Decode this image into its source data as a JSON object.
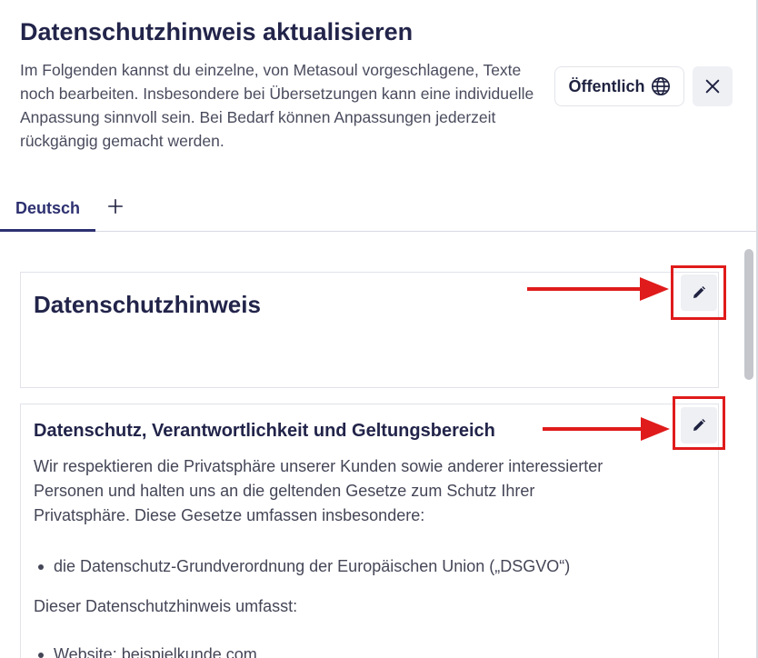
{
  "header": {
    "title": "Datenschutzhinweis aktualisieren",
    "description": "Im Folgenden kannst du einzelne, von Metasoul vorgeschlagene, Texte noch bearbeiten. Insbesondere bei Übersetzungen kann eine individuelle Anpassung sinnvoll sein. Bei Bedarf können Anpassungen jederzeit rückgängig gemacht werden.",
    "visibility_label": "Öffentlich",
    "visibility_icon": "globe-icon",
    "close_icon": "close-icon"
  },
  "tabs": {
    "active_label": "Deutsch",
    "add_icon": "plus-icon"
  },
  "sections": [
    {
      "heading": "Datenschutzhinweis",
      "edit_icon": "pencil-icon"
    },
    {
      "heading": "Datenschutz, Verantwortlichkeit und Geltungsbereich",
      "paragraph": "Wir respektieren die Privatsphäre unserer Kunden sowie anderer interessierter Personen und halten uns an die geltenden Gesetze zum Schutz Ihrer Privatsphäre. Diese Gesetze umfassen insbesondere:",
      "bullet": "die Datenschutz-Grundverordnung der Europäischen Union („DSGVO“)",
      "paragraph2": "Dieser Datenschutzhinweis umfasst:",
      "bullet2": "Website: beispielkunde.com",
      "edit_icon": "pencil-icon"
    }
  ],
  "colors": {
    "accent": "#2d3070",
    "annotation": "#e01b1b",
    "button_bg": "#eef0f4"
  }
}
